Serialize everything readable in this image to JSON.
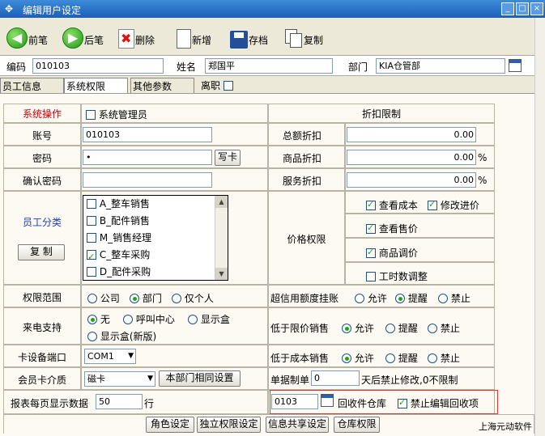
{
  "window": {
    "title": "编辑用户设定"
  },
  "toolbar": {
    "prev": "前笔",
    "next": "后笔",
    "delete": "删除",
    "add": "新增",
    "save": "存档",
    "copy": "复制"
  },
  "header": {
    "code_label": "编码",
    "code_value": "010103",
    "name_label": "姓名",
    "name_value": "郑国平",
    "dept_label": "部门",
    "dept_value": "KIA仓管部"
  },
  "tabs": [
    "员工信息",
    "系统权限",
    "其他参数",
    "离职"
  ],
  "perm": {
    "sys_op_label": "系统操作",
    "sys_admin": "系统管理员",
    "account_label": "账号",
    "account_value": "010103",
    "password_label": "密码",
    "password_value": "•",
    "write_card": "写卡",
    "confirm_label": "确认密码",
    "emp_category_label": "员工分类",
    "copy_btn": "复 制",
    "categories": [
      {
        "label": "A_整车销售",
        "checked": false
      },
      {
        "label": "B_配件销售",
        "checked": false
      },
      {
        "label": "M_销售经理",
        "checked": false
      },
      {
        "label": "C_整车采购",
        "checked": true
      },
      {
        "label": "D_配件采购",
        "checked": false
      }
    ],
    "discount_header": "折扣限制",
    "total_discount_label": "总额折扣",
    "total_discount": "0.00",
    "goods_discount_label": "商品折扣",
    "goods_discount": "0.00",
    "goods_pct": "%",
    "service_discount_label": "服务折扣",
    "service_discount": "0.00",
    "service_pct": "%",
    "price_perm_label": "价格权限",
    "view_cost": "查看成本",
    "edit_purchase": "修改进价",
    "view_sale": "查看售价",
    "goods_adjust": "商品调价",
    "labor_adjust": "工时数调整",
    "scope_label": "权限范围",
    "scope_company": "公司",
    "scope_dept": "部门",
    "scope_self": "仅个人",
    "credit_label": "超信用额度挂账",
    "allow": "允许",
    "remind": "提醒",
    "forbid": "禁止",
    "call_label": "来电支持",
    "call_none": "无",
    "call_center": "呼叫中心",
    "call_box": "显示盒",
    "call_box_new": "显示盒(新版)",
    "below_limit_label": "低于限价销售",
    "card_port_label": "卡设备端口",
    "card_port_value": "COM1",
    "below_cost_label": "低于成本销售",
    "member_card_label": "会员卡介质",
    "member_card_value": "磁卡",
    "same_dept_btn": "本部门相同设置",
    "doc_label": "单据制单",
    "doc_days": "0",
    "doc_suffix": "天后禁止修改,0不限制",
    "report_rows_label": "报表每页显示数据",
    "report_rows_value": "50",
    "report_rows_unit": "行",
    "return_wh_value": "0103",
    "return_wh_label": "回收件仓库",
    "forbid_edit_return": "禁止编辑回收项"
  },
  "bottom": {
    "role": "角色设定",
    "indep": "独立权限设定",
    "info_share": "信息共享设定",
    "warehouse": "仓库权限",
    "brand": "上海元动软件"
  }
}
